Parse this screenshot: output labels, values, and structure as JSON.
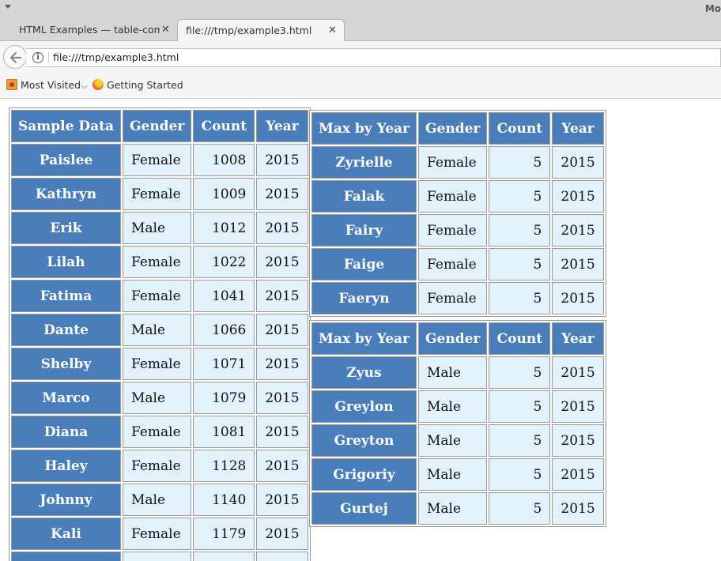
{
  "window": {
    "corner_text": "Mo"
  },
  "tabs": [
    {
      "label": "HTML Examples — table-compo",
      "active": false
    },
    {
      "label": "file:///tmp/example3.html",
      "active": true
    }
  ],
  "new_tab_label": "+",
  "address_bar": {
    "url": "file:///tmp/example3.html"
  },
  "bookmarks": [
    {
      "label": "Most Visited",
      "icon": "folder-icon",
      "has_dropdown": true
    },
    {
      "label": "Getting Started",
      "icon": "firefox-icon",
      "has_dropdown": false
    }
  ],
  "sample_table": {
    "headers": [
      "Sample Data",
      "Gender",
      "Count",
      "Year"
    ],
    "rows": [
      [
        "Paislee",
        "Female",
        "1008",
        "2015"
      ],
      [
        "Kathryn",
        "Female",
        "1009",
        "2015"
      ],
      [
        "Erik",
        "Male",
        "1012",
        "2015"
      ],
      [
        "Lilah",
        "Female",
        "1022",
        "2015"
      ],
      [
        "Fatima",
        "Female",
        "1041",
        "2015"
      ],
      [
        "Dante",
        "Male",
        "1066",
        "2015"
      ],
      [
        "Shelby",
        "Female",
        "1071",
        "2015"
      ],
      [
        "Marco",
        "Male",
        "1079",
        "2015"
      ],
      [
        "Diana",
        "Female",
        "1081",
        "2015"
      ],
      [
        "Haley",
        "Female",
        "1128",
        "2015"
      ],
      [
        "Johnny",
        "Male",
        "1140",
        "2015"
      ],
      [
        "Kali",
        "Female",
        "1179",
        "2015"
      ],
      [
        "",
        "",
        "",
        ""
      ]
    ]
  },
  "female_max_table": {
    "headers": [
      "Max by Year",
      "Gender",
      "Count",
      "Year"
    ],
    "rows": [
      [
        "Zyrielle",
        "Female",
        "5",
        "2015"
      ],
      [
        "Falak",
        "Female",
        "5",
        "2015"
      ],
      [
        "Fairy",
        "Female",
        "5",
        "2015"
      ],
      [
        "Faige",
        "Female",
        "5",
        "2015"
      ],
      [
        "Faeryn",
        "Female",
        "5",
        "2015"
      ]
    ]
  },
  "male_max_table": {
    "headers": [
      "Max by Year",
      "Gender",
      "Count",
      "Year"
    ],
    "rows": [
      [
        "Zyus",
        "Male",
        "5",
        "2015"
      ],
      [
        "Greylon",
        "Male",
        "5",
        "2015"
      ],
      [
        "Greyton",
        "Male",
        "5",
        "2015"
      ],
      [
        "Grigoriy",
        "Male",
        "5",
        "2015"
      ],
      [
        "Gurtej",
        "Male",
        "5",
        "2015"
      ]
    ]
  },
  "colors": {
    "header_bg": "#4a7ebb",
    "cell_bg": "#e3f1fb",
    "header_text": "#ffffff"
  }
}
